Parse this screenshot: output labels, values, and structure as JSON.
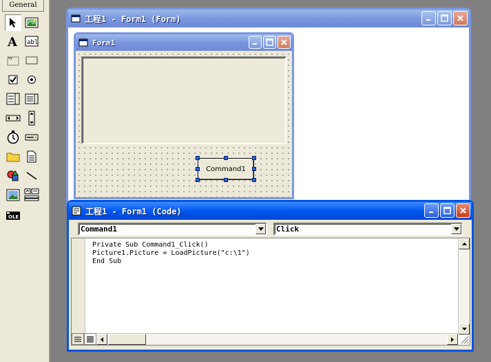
{
  "toolbox": {
    "tab_label": "General",
    "tools": [
      "pointer-tool",
      "picturebox-tool",
      "label-tool",
      "textbox-tool",
      "frame-tool",
      "commandbutton-tool",
      "checkbox-tool",
      "optionbutton-tool",
      "combobox-tool",
      "listbox-tool",
      "hscrollbar-tool",
      "vscrollbar-tool",
      "timer-tool",
      "drivelistbox-tool",
      "dirlistbox-tool",
      "filelistbox-tool",
      "shape-tool",
      "line-tool",
      "image-tool",
      "data-tool",
      "ole-tool"
    ]
  },
  "form_designer": {
    "title": "工程1 - Form1 (Form)",
    "inner_form_title": "Form1",
    "command_button_caption": "Command1"
  },
  "code_window": {
    "title": "工程1 - Form1 (Code)",
    "object_combo": "Command1",
    "procedure_combo": "Click",
    "code_lines": [
      "Private Sub Command1_Click()",
      "Picture1.Picture = LoadPicture(\"c:\\1\")",
      "End Sub"
    ]
  },
  "colors": {
    "active_title": "#0058ee",
    "inactive_title": "#7a96df",
    "face": "#ece9d8",
    "desktop": "#808080"
  }
}
